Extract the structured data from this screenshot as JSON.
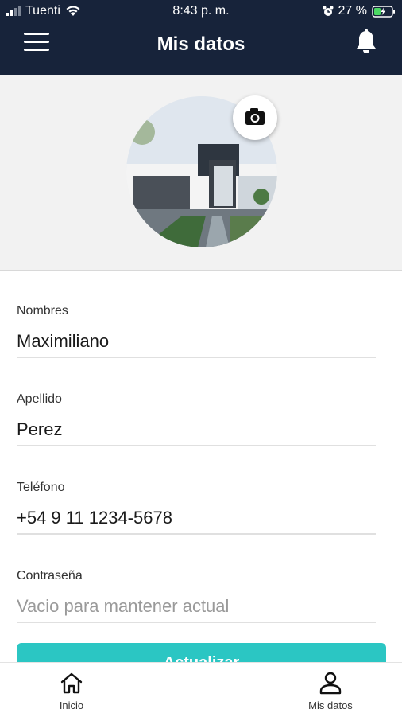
{
  "status_bar": {
    "carrier": "Tuenti",
    "time": "8:43 p. m.",
    "battery": "27 %"
  },
  "header": {
    "title": "Mis datos",
    "menu_icon": "hamburger-icon",
    "notifications_icon": "bell-icon"
  },
  "profile": {
    "camera_icon": "camera-icon"
  },
  "form": {
    "fields": [
      {
        "label": "Nombres",
        "value": "Maximiliano",
        "placeholder": ""
      },
      {
        "label": "Apellido",
        "value": "Perez",
        "placeholder": ""
      },
      {
        "label": "Teléfono",
        "value": "+54 9 11 1234-5678",
        "placeholder": ""
      },
      {
        "label": "Contraseña",
        "value": "",
        "placeholder": "Vacio para mantener actual"
      }
    ],
    "submit_label": "Actualizar"
  },
  "tabbar": {
    "tabs": [
      {
        "label": "Inicio",
        "icon": "home-icon"
      },
      {
        "label": "Mis datos",
        "icon": "user-icon"
      }
    ]
  },
  "colors": {
    "header_bg": "#17233a",
    "accent": "#2bc6c3"
  }
}
